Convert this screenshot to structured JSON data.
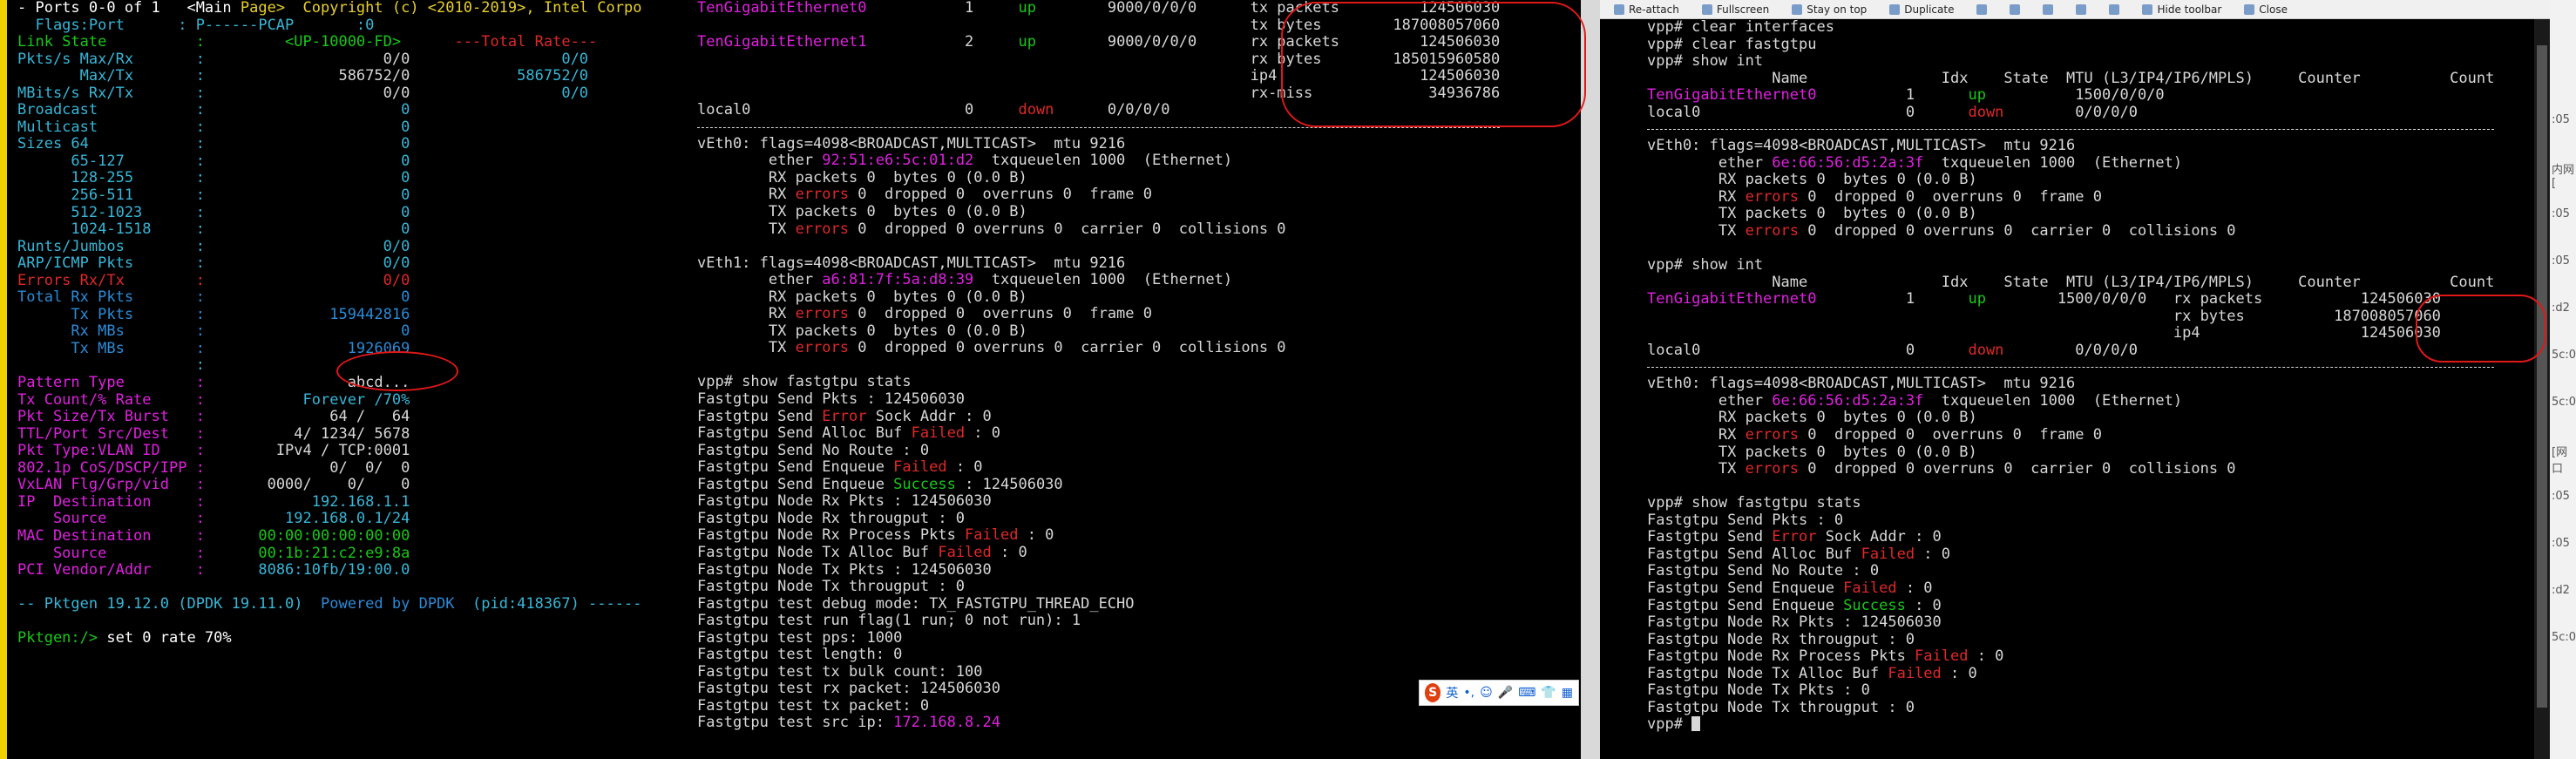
{
  "left": {
    "header": [
      "- Ports 0-0 of 1   <Main Page>  Copyright (c) <2010-2019>, Intel Corpo",
      "  Flags:Port      : P------PCAP       :0"
    ],
    "rows": [
      {
        "k": "Link State",
        "v": "<UP-10000-FD>",
        "t": "---Total Rate---",
        "kc": "gr",
        "vc": "gr",
        "tc": "rd"
      },
      {
        "k": "Pkts/s Max/Rx",
        "v": "0/0",
        "t": "0/0",
        "kc": "cy",
        "vc": "wh",
        "tc": "cy"
      },
      {
        "k": "       Max/Tx",
        "v": "586752/0",
        "t": "586752/0",
        "kc": "cy",
        "vc": "wh",
        "tc": "cy"
      },
      {
        "k": "MBits/s Rx/Tx",
        "v": "0/0",
        "t": "0/0",
        "kc": "cy",
        "vc": "wh",
        "tc": "cy"
      },
      {
        "k": "Broadcast",
        "v": "0",
        "t": "",
        "kc": "cy",
        "vc": "cy",
        "tc": "cy"
      },
      {
        "k": "Multicast",
        "v": "0",
        "t": "",
        "kc": "cy",
        "vc": "cy",
        "tc": "cy"
      },
      {
        "k": "Sizes 64",
        "v": "0",
        "t": "",
        "kc": "cy",
        "vc": "cy",
        "tc": "cy"
      },
      {
        "k": "      65-127",
        "v": "0",
        "t": "",
        "kc": "cy",
        "vc": "cy",
        "tc": "cy"
      },
      {
        "k": "      128-255",
        "v": "0",
        "t": "",
        "kc": "cy",
        "vc": "cy",
        "tc": "cy"
      },
      {
        "k": "      256-511",
        "v": "0",
        "t": "",
        "kc": "cy",
        "vc": "cy",
        "tc": "cy"
      },
      {
        "k": "      512-1023",
        "v": "0",
        "t": "",
        "kc": "cy",
        "vc": "cy",
        "tc": "cy"
      },
      {
        "k": "      1024-1518",
        "v": "0",
        "t": "",
        "kc": "cy",
        "vc": "cy",
        "tc": "cy"
      },
      {
        "k": "Runts/Jumbos",
        "v": "0/0",
        "t": "",
        "kc": "cy",
        "vc": "cy",
        "tc": "cy"
      },
      {
        "k": "ARP/ICMP Pkts",
        "v": "0/0",
        "t": "",
        "kc": "cy",
        "vc": "cy",
        "tc": "cy"
      },
      {
        "k": "Errors Rx/Tx",
        "v": "0/0",
        "t": "",
        "kc": "rd",
        "vc": "rd",
        "tc": "rd"
      },
      {
        "k": "Total Rx Pkts",
        "v": "0",
        "t": "",
        "kc": "bl",
        "vc": "bl",
        "tc": "bl"
      },
      {
        "k": "      Tx Pkts",
        "v": "159442816",
        "t": "",
        "kc": "bl",
        "vc": "bl",
        "tc": "bl"
      },
      {
        "k": "      Rx MBs",
        "v": "0",
        "t": "",
        "kc": "bl",
        "vc": "bl",
        "tc": "bl"
      },
      {
        "k": "      Tx MBs",
        "v": "1926069",
        "t": "",
        "kc": "bl",
        "vc": "bl",
        "tc": "bl"
      },
      {
        "k": "",
        "v": "",
        "t": "",
        "kc": "cy",
        "vc": "cy",
        "tc": "cy"
      },
      {
        "k": "Pattern Type",
        "v": "abcd...",
        "t": "",
        "kc": "mg",
        "vc": "wh",
        "tc": "wh"
      },
      {
        "k": "Tx Count/% Rate",
        "v": "Forever /70%",
        "t": "",
        "kc": "mg",
        "vc": "cy",
        "tc": "wh"
      },
      {
        "k": "Pkt Size/Tx Burst",
        "v": "64 /   64",
        "t": "",
        "kc": "mg",
        "vc": "wh",
        "tc": "wh"
      },
      {
        "k": "TTL/Port Src/Dest",
        "v": "4/ 1234/ 5678",
        "t": "",
        "kc": "mg",
        "vc": "wh",
        "tc": "wh"
      },
      {
        "k": "Pkt Type:VLAN ID",
        "v": "IPv4 / TCP:0001",
        "t": "",
        "kc": "mg",
        "vc": "wh",
        "tc": "wh"
      },
      {
        "k": "802.1p CoS/DSCP/IPP",
        "v": "0/  0/  0",
        "t": "",
        "kc": "mg",
        "vc": "wh",
        "tc": "wh"
      },
      {
        "k": "VxLAN Flg/Grp/vid",
        "v": "0000/    0/    0",
        "t": "",
        "kc": "mg",
        "vc": "wh",
        "tc": "wh"
      },
      {
        "k": "IP  Destination",
        "v": "192.168.1.1",
        "t": "",
        "kc": "mg",
        "vc": "cy",
        "tc": "wh"
      },
      {
        "k": "    Source",
        "v": "192.168.0.1/24",
        "t": "",
        "kc": "mg",
        "vc": "cy",
        "tc": "wh"
      },
      {
        "k": "MAC Destination",
        "v": "00:00:00:00:00:00",
        "t": "",
        "kc": "mg",
        "vc": "gr",
        "tc": "wh"
      },
      {
        "k": "    Source",
        "v": "00:1b:21:c2:e9:8a",
        "t": "",
        "kc": "mg",
        "vc": "gr",
        "tc": "wh"
      },
      {
        "k": "PCI Vendor/Addr",
        "v": "8086:10fb/19:00.0",
        "t": "",
        "kc": "mg",
        "vc": "cy",
        "tc": "wh"
      }
    ],
    "footer_pre": "-- Pktgen 19.12.0 (DPDK 19.11.0)  ",
    "footer_powered": "Powered by DPDK",
    "footer_post": "  (pid:418367) ------",
    "prompt": "Pktgen:/> ",
    "command": "set 0 rate 70%"
  },
  "mid": {
    "iface_rows": [
      {
        "name": "TenGigabitEthernet0",
        "idx": "1",
        "state": "up",
        "mtu": "9000/0/0/0",
        "counter": "tx packets",
        "count": "124506030"
      },
      {
        "name": "",
        "idx": "",
        "state": "",
        "mtu": "",
        "counter": "tx bytes",
        "count": "187008057060"
      },
      {
        "name": "TenGigabitEthernet1",
        "idx": "2",
        "state": "up",
        "mtu": "9000/0/0/0",
        "counter": "rx packets",
        "count": "124506030"
      },
      {
        "name": "",
        "idx": "",
        "state": "",
        "mtu": "",
        "counter": "rx bytes",
        "count": "185015960580"
      },
      {
        "name": "",
        "idx": "",
        "state": "",
        "mtu": "",
        "counter": "ip4",
        "count": "124506030"
      },
      {
        "name": "",
        "idx": "",
        "state": "",
        "mtu": "",
        "counter": "rx-miss",
        "count": "34936786"
      },
      {
        "name": "local0",
        "idx": "0",
        "state": "down",
        "mtu": "0/0/0/0",
        "counter": "",
        "count": ""
      }
    ],
    "veth0": {
      "head": "vEth0: flags=4098<BROADCAST,MULTICAST>  mtu 9216",
      "ether": "92:51:e6:5c:01:d2",
      "txq": "  txqueuelen 1000  (Ethernet)"
    },
    "veth1": {
      "head": "vEth1: flags=4098<BROADCAST,MULTICAST>  mtu 9216",
      "ether": "a6:81:7f:5a:d8:39",
      "txq": "  txqueuelen 1000  (Ethernet)"
    },
    "stats_cmd": "vpp# show fastgtpu stats",
    "stats": [
      [
        "Fastgtpu Send Pkts : 124506030"
      ],
      [
        "Fastgtpu Send ",
        "Error",
        " Sock Addr : 0"
      ],
      [
        "Fastgtpu Send Alloc Buf ",
        "Failed",
        " : 0"
      ],
      [
        "Fastgtpu Send No Route : 0"
      ],
      [
        "Fastgtpu Send Enqueue ",
        "Failed",
        " : 0"
      ],
      [
        "Fastgtpu Send Enqueue ",
        "Success",
        " : 124506030"
      ],
      [
        "Fastgtpu Node Rx Pkts : 124506030"
      ],
      [
        "Fastgtpu Node Rx througput : 0"
      ],
      [
        "Fastgtpu Node Rx Process Pkts ",
        "Failed",
        " : 0"
      ],
      [
        "Fastgtpu Node Tx Alloc Buf ",
        "Failed",
        " : 0"
      ],
      [
        "Fastgtpu Node Tx Pkts : 124506030"
      ],
      [
        "Fastgtpu Node Tx througput : 0"
      ],
      [
        "Fastgtpu test debug mode: TX_FASTGTPU_THREAD_ECHO"
      ],
      [
        "Fastgtpu test run flag(1 run; 0 not run): 1"
      ],
      [
        "Fastgtpu test pps: 1000"
      ],
      [
        "Fastgtpu test length: 0"
      ],
      [
        "Fastgtpu test tx bulk count: 100"
      ],
      [
        "Fastgtpu test rx packet: 124506030"
      ],
      [
        "Fastgtpu test tx packet: 0"
      ]
    ],
    "src_ip_label": "Fastgtpu test src ip: ",
    "src_ip": "172.168.8.24"
  },
  "ifconfig": {
    "rx": "RX packets 0  bytes 0 (0.0 B)",
    "rx_err_pre": "RX ",
    "rx_err_word": "errors",
    "rx_err_post": " 0  dropped 0  overruns 0  frame 0",
    "tx": "TX packets 0  bytes 0 (0.0 B)",
    "tx_err_pre": "TX ",
    "tx_err_word": "errors",
    "tx_err_post": " 0  dropped 0 overruns 0  carrier 0  collisions 0",
    "ether_label": "ether "
  },
  "right": {
    "toolbar": [
      "Re-attach",
      "Fullscreen",
      "Stay on top",
      "Duplicate",
      "",
      "",
      "",
      "",
      "",
      "Hide toolbar",
      "Close"
    ],
    "cmds1": [
      "vpp# clear interfaces",
      "vpp# clear fastgtpu",
      "vpp# show int"
    ],
    "hdr": "              Name               Idx    State  MTU (L3/IP4/IP6/MPLS)     Counter          Count",
    "int1_name": "TenGigabitEthernet0",
    "int1_idx": "1",
    "int1_state": "up",
    "int1_mtu": "1500/0/0/0",
    "local0": "local0",
    "local0_idx": "0",
    "local0_state": "down",
    "local0_mtu": "0/0/0/0",
    "veth0_head": "vEth0: flags=4098<BROADCAST,MULTICAST>  mtu 9216",
    "veth0_ether": "6e:66:56:d5:2a:3f",
    "txq": "  txqueuelen 1000  (Ethernet)",
    "cmd2": "vpp# show int",
    "counters": [
      [
        "rx packets",
        "124506030"
      ],
      [
        "rx bytes",
        "187008057060"
      ],
      [
        "ip4",
        "124506030"
      ]
    ],
    "stats_cmd": "vpp# show fastgtpu stats",
    "stats": [
      [
        "Fastgtpu Send Pkts : 0"
      ],
      [
        "Fastgtpu Send ",
        "Error",
        " Sock Addr : 0"
      ],
      [
        "Fastgtpu Send Alloc Buf ",
        "Failed",
        " : 0"
      ],
      [
        "Fastgtpu Send No Route : 0"
      ],
      [
        "Fastgtpu Send Enqueue ",
        "Failed",
        " : 0"
      ],
      [
        "Fastgtpu Send Enqueue ",
        "Success",
        " : 0"
      ],
      [
        "Fastgtpu Node Rx Pkts : 124506030"
      ],
      [
        "Fastgtpu Node Rx througput : 0"
      ],
      [
        "Fastgtpu Node Rx Process Pkts ",
        "Failed",
        " : 0"
      ],
      [
        "Fastgtpu Node Tx Alloc Buf ",
        "Failed",
        " : 0"
      ],
      [
        "Fastgtpu Node Tx Pkts : 0"
      ],
      [
        "Fastgtpu Node Tx througput : 0"
      ]
    ],
    "prompt": "vpp# "
  },
  "ime": {
    "lang": "英"
  },
  "edge": {
    "labels": [
      ":05",
      "内网[",
      ":05",
      ":05",
      ":d2",
      "5c:0",
      "5c:0",
      "[网口",
      ":05",
      ":05",
      ":d2",
      "5c:0"
    ]
  },
  "colors": {
    "cyan": "#37b7d8",
    "magenta": "#e020e0",
    "green": "#18c818",
    "red": "#e02828",
    "yellow": "#e8d02a",
    "annotation": "#e01818"
  }
}
